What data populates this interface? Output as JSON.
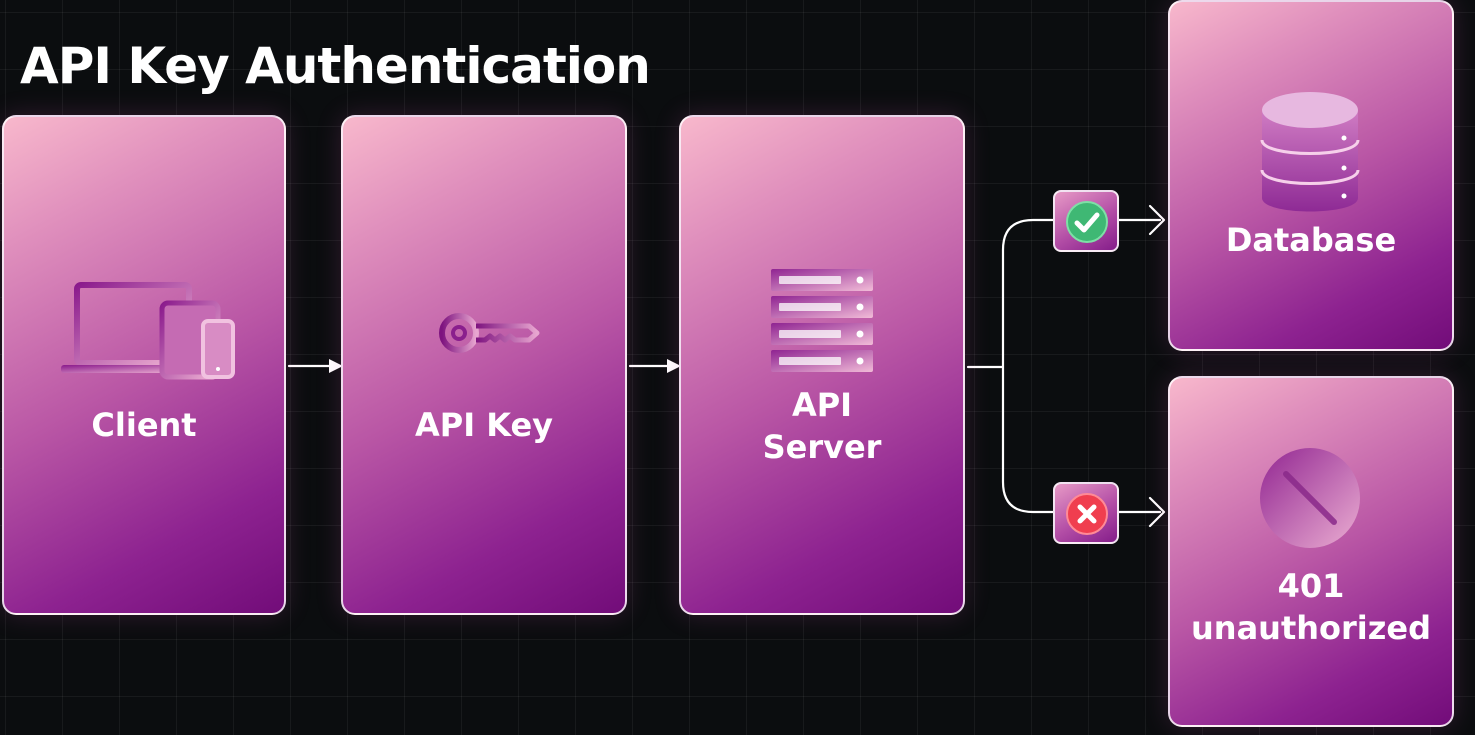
{
  "title": "API Key Authentication",
  "nodes": {
    "client": {
      "label": "Client",
      "icon": "devices-icon"
    },
    "api_key": {
      "label": "API Key",
      "icon": "key-icon"
    },
    "api_server": {
      "label": "API\nServer",
      "icon": "server-rack-icon"
    },
    "database": {
      "label": "Database",
      "icon": "database-icon"
    },
    "unauthorized": {
      "label": "401\nunauthorized",
      "icon": "blocked-icon"
    }
  },
  "branches": {
    "success": {
      "icon": "check-icon",
      "color": "#3fb874"
    },
    "failure": {
      "icon": "close-icon",
      "color": "#f03e4f"
    }
  },
  "colors": {
    "background": "#0b0d0f",
    "card_gradient_start": "#f8b8cc",
    "card_gradient_end": "#720c79",
    "connector": "#ffffff"
  }
}
